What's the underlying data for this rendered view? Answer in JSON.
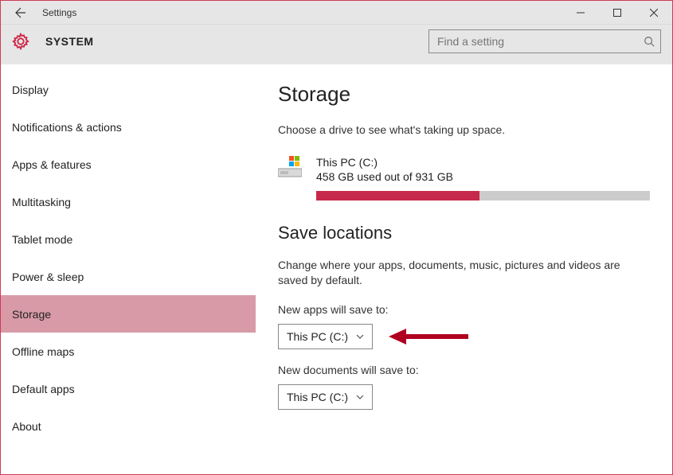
{
  "window": {
    "title": "Settings"
  },
  "header": {
    "system_label": "SYSTEM",
    "search_placeholder": "Find a setting"
  },
  "sidebar": {
    "items": [
      {
        "label": "Display"
      },
      {
        "label": "Notifications & actions"
      },
      {
        "label": "Apps & features"
      },
      {
        "label": "Multitasking"
      },
      {
        "label": "Tablet mode"
      },
      {
        "label": "Power & sleep"
      },
      {
        "label": "Storage",
        "selected": true
      },
      {
        "label": "Offline maps"
      },
      {
        "label": "Default apps"
      },
      {
        "label": "About"
      }
    ]
  },
  "storage": {
    "heading": "Storage",
    "lead": "Choose a drive to see what's taking up space.",
    "drive": {
      "name": "This PC (C:)",
      "usage_text": "458 GB used out of 931 GB",
      "used_gb": 458,
      "total_gb": 931,
      "percent_used": 49
    }
  },
  "save_locations": {
    "heading": "Save locations",
    "lead": "Change where your apps, documents, music, pictures and videos are saved by default.",
    "items": [
      {
        "label": "New apps will save to:",
        "value": "This PC (C:)"
      },
      {
        "label": "New documents will save to:",
        "value": "This PC (C:)"
      }
    ]
  },
  "colors": {
    "accent": "#c6294b",
    "selection": "#d89aa7"
  }
}
